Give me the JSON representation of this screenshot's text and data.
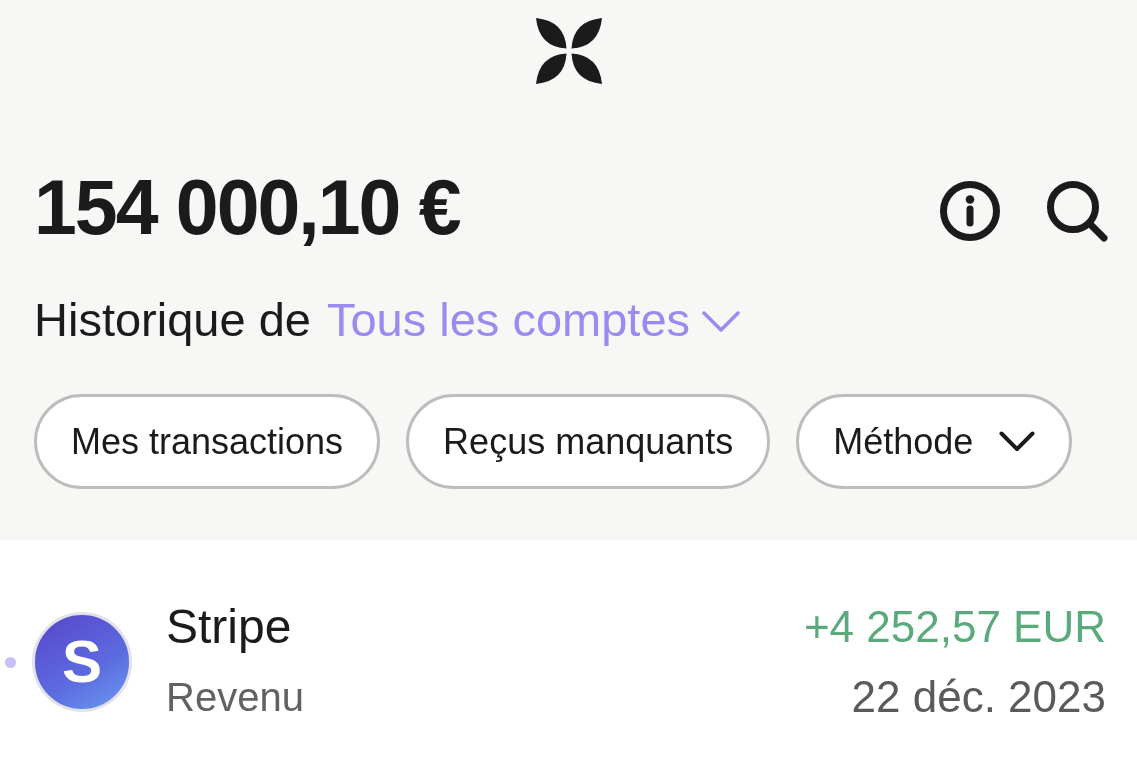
{
  "balance": {
    "amount": "154 000,10 €"
  },
  "history": {
    "prefix": "Historique de",
    "account": "Tous les comptes"
  },
  "filters": [
    {
      "label": "Mes transactions",
      "kind": "toggle",
      "selected": false
    },
    {
      "label": "Reçus manquants",
      "kind": "toggle",
      "selected": false
    },
    {
      "label": "Méthode",
      "kind": "dropdown",
      "selected": false
    }
  ],
  "transactions": [
    {
      "name": "Stripe",
      "avatar_letter": "S",
      "category": "Revenu",
      "amount": "+4 252,57 EUR",
      "date": "22 déc. 2023",
      "kind": "credit",
      "unread": true
    }
  ]
}
